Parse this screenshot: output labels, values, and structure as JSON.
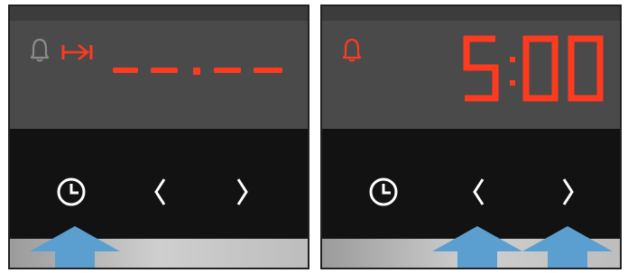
{
  "colors": {
    "display_bg": "#4a4a4a",
    "control_bg": "#121212",
    "led_red": "#ff3b1f",
    "icon_grey": "#8c8c8c",
    "icon_white": "#ffffff",
    "pointer_blue": "#5b9fd0"
  },
  "left_panel": {
    "icons": [
      "bell-outline-icon",
      "skip-to-end-icon"
    ],
    "display_text": "– –.– –",
    "buttons": [
      {
        "icon": "clock-icon",
        "highlighted": true
      },
      {
        "icon": "chevron-left-icon",
        "highlighted": false
      },
      {
        "icon": "chevron-right-icon",
        "highlighted": false
      }
    ]
  },
  "right_panel": {
    "icons": [
      "bell-outline-icon"
    ],
    "display_text": "5:00",
    "buttons": [
      {
        "icon": "clock-icon",
        "highlighted": false
      },
      {
        "icon": "chevron-left-icon",
        "highlighted": true
      },
      {
        "icon": "chevron-right-icon",
        "highlighted": true
      }
    ]
  }
}
